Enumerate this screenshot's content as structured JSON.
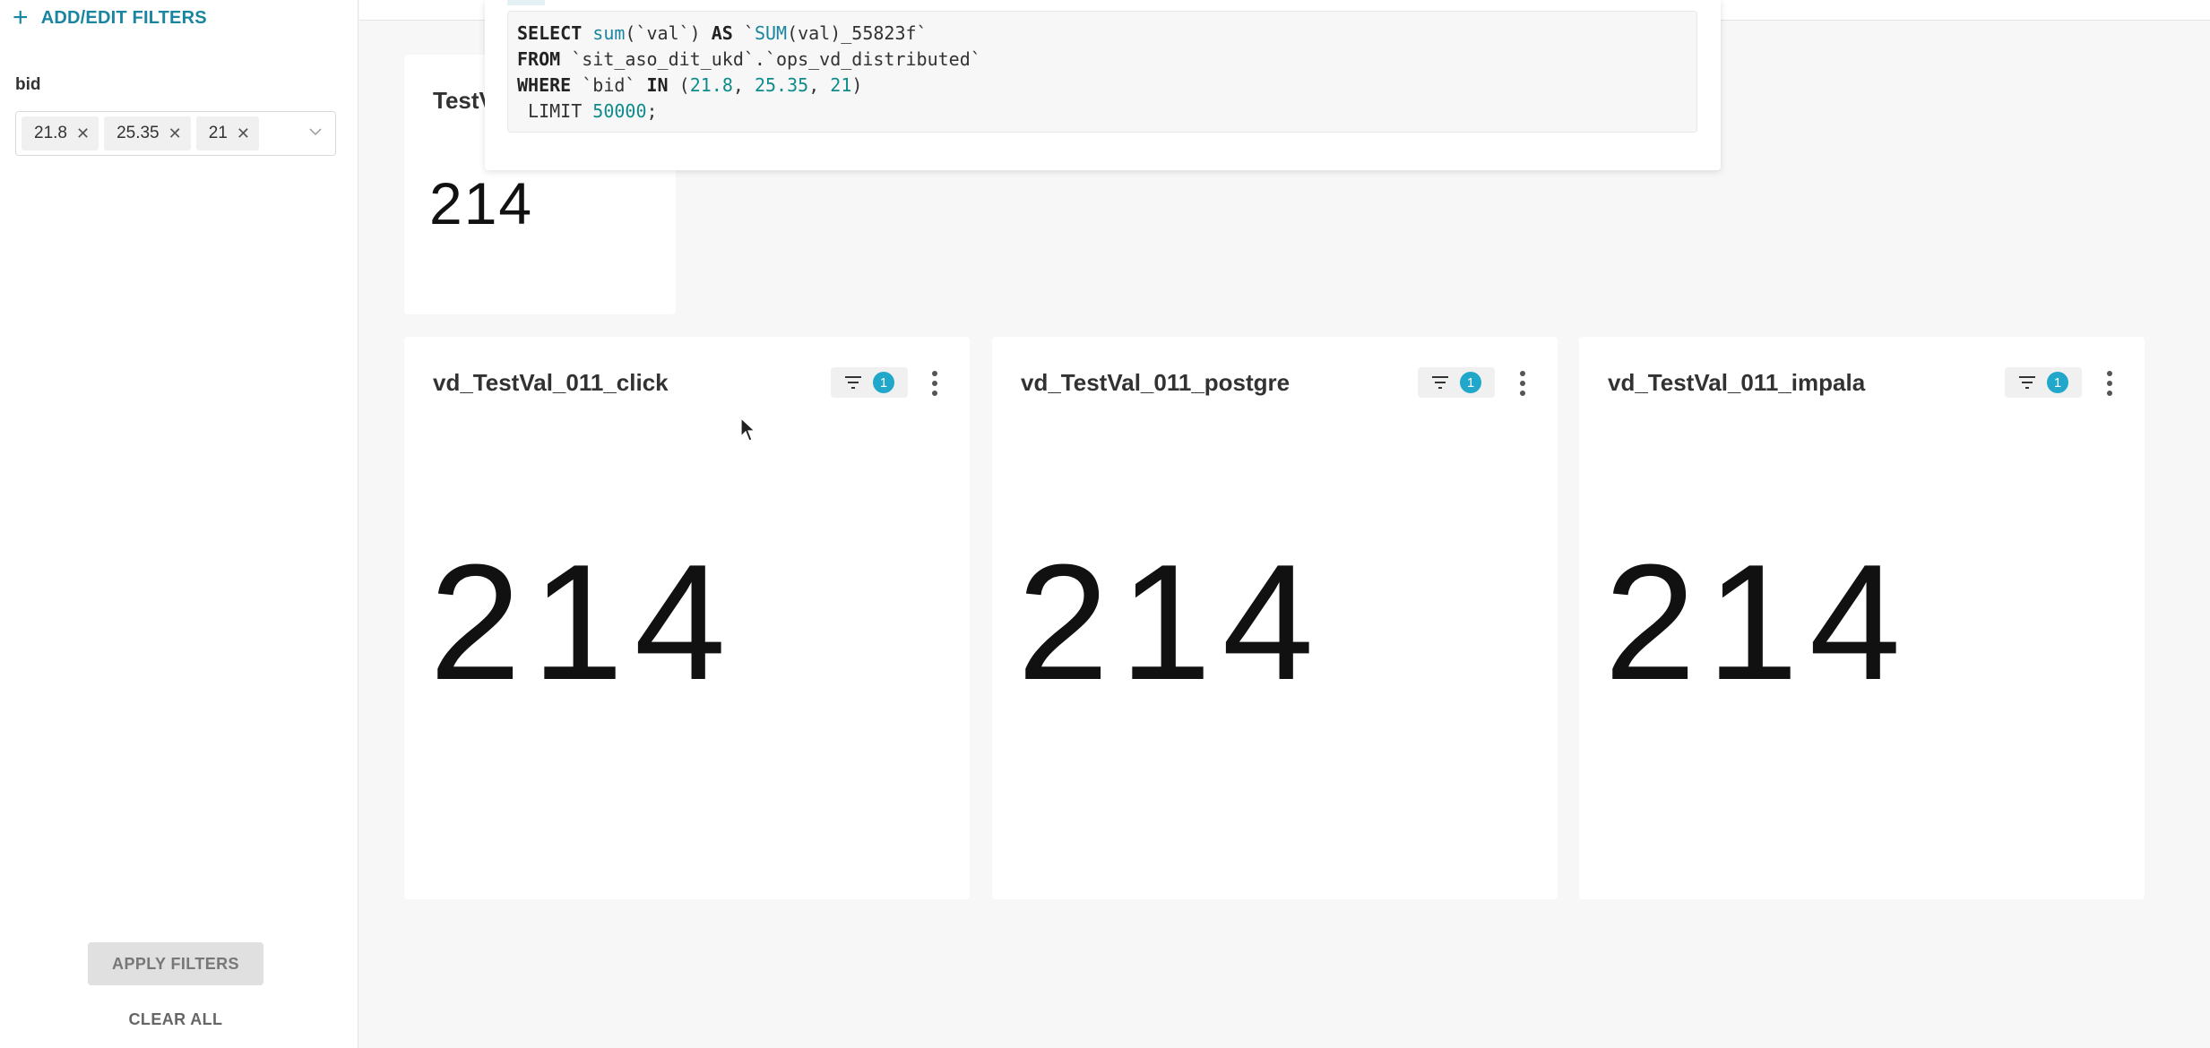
{
  "sidebar": {
    "add_filters_label": "ADD/EDIT FILTERS",
    "filter": {
      "label": "bid",
      "selected_values": [
        "21.8",
        "25.35",
        "21"
      ]
    },
    "apply_label": "APPLY FILTERS",
    "clear_label": "CLEAR ALL"
  },
  "top_card": {
    "title_visible": "TestV",
    "value": "214"
  },
  "sql_popover": {
    "line1_kw1": "SELECT",
    "line1_fn1": "sum",
    "line1_mid": "(`val`) ",
    "line1_kw2": "AS",
    "line1_sp": " `",
    "line1_fn2": "SUM",
    "line1_end": "(val)_55823f`",
    "line2_kw": "FROM",
    "line2_rest": " `sit_aso_dit_ukd`.`ops_vd_distributed`",
    "line3_kw": "WHERE",
    "line3_a": " `bid` ",
    "line3_kw2": "IN",
    "line3_b": " (",
    "line3_n1": "21.8",
    "line3_c": ", ",
    "line3_n2": "25.35",
    "line3_d": ", ",
    "line3_n3": "21",
    "line3_e": ")",
    "line4_kw": " LIMIT ",
    "line4_num": "50000",
    "line4_end": ";"
  },
  "cards": [
    {
      "title": "vd_TestVal_011_click",
      "filter_count": "1",
      "value": "214"
    },
    {
      "title": "vd_TestVal_011_postgre",
      "filter_count": "1",
      "value": "214"
    },
    {
      "title": "vd_TestVal_011_impala",
      "filter_count": "1",
      "value": "214"
    }
  ],
  "colors": {
    "accent": "#1a85a0",
    "badge": "#20a7c9",
    "background": "#f7f7f7"
  },
  "icons": {
    "filter": "filter-icon",
    "menu": "more-vertical-icon",
    "close": "close-icon",
    "dropdown": "chevron-down-icon",
    "plus": "plus-icon",
    "cursor": "mouse-pointer-icon"
  }
}
